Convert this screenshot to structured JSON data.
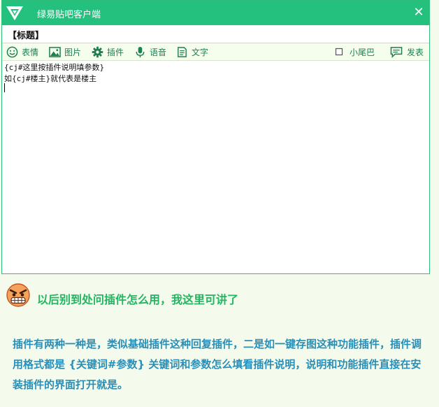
{
  "window": {
    "title": "绿易贴吧客户端",
    "close_label": "✕"
  },
  "subject": {
    "value": "【标题】"
  },
  "toolbar": {
    "emoji_label": "表情",
    "image_label": "图片",
    "plugin_label": "插件",
    "voice_label": "语音",
    "text_label": "文字",
    "tail_label": "小尾巴",
    "post_label": "发表"
  },
  "editor": {
    "lines": [
      "{cj#这里按插件说明填参数}",
      "如{cj#楼主}就代表是楼主"
    ]
  },
  "notice": {
    "text": "以后别到处问插件怎么用，我这里可讲了"
  },
  "body": {
    "paragraph": "插件有两种一种是，类似基础插件这种回复插件，二是如一键存图这种功能插件，插件调用格式都是 {关键词#参数} 关键词和参数怎么填看插件说明，说明和功能插件直接在安装插件的界面打开就是。"
  },
  "colors": {
    "titlebar": "#24c17e",
    "toolbar_text": "#1f7e54",
    "notice_text": "#22b663",
    "body_text": "#2a8fb8"
  },
  "icons": [
    "triangle-logo-icon",
    "smiley-icon",
    "image-icon",
    "gear-icon",
    "microphone-icon",
    "document-icon",
    "checkbox-icon",
    "comment-icon",
    "angry-face-icon"
  ]
}
